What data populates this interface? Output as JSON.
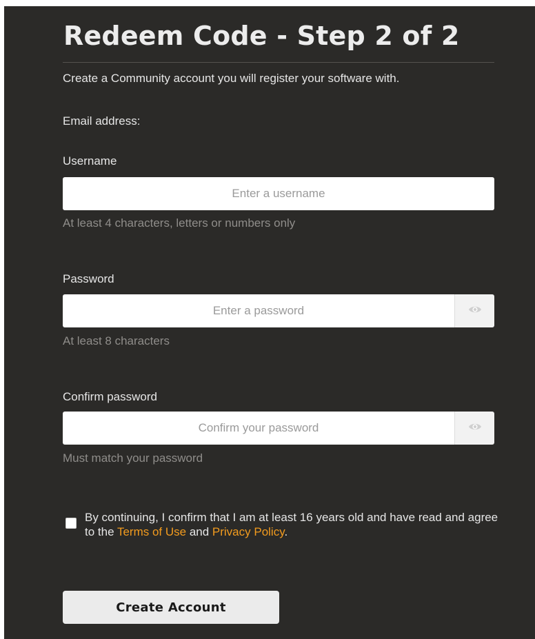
{
  "page": {
    "title": "Redeem Code - Step 2 of 2",
    "subtitle": "Create a Community account you will register your software with."
  },
  "form": {
    "email_label": "Email address:",
    "username": {
      "label": "Username",
      "placeholder": "Enter a username",
      "value": "",
      "hint": "At least 4 characters, letters or numbers only"
    },
    "password": {
      "label": "Password",
      "placeholder": "Enter a password",
      "value": "",
      "hint": "At least 8 characters",
      "toggle_icon": "eye-icon"
    },
    "confirm_password": {
      "label": "Confirm password",
      "placeholder": "Confirm your password",
      "value": "",
      "hint": "Must match your password",
      "toggle_icon": "eye-icon"
    },
    "agreement": {
      "checked": false,
      "text_before": "By continuing, I confirm that I am at least 16 years old and have read and agree to the ",
      "terms_link": "Terms of Use",
      "text_middle": " and ",
      "privacy_link": "Privacy Policy",
      "text_after": "."
    },
    "submit_label": "Create Account"
  },
  "colors": {
    "background": "#2b2a28",
    "link": "#f29b1e",
    "text": "#e6e6e6",
    "hint": "#8f8d8a"
  }
}
